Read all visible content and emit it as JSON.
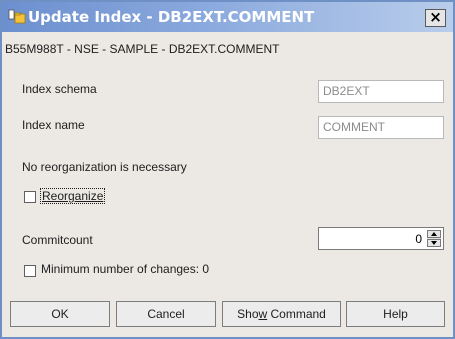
{
  "window": {
    "title": "Update Index - DB2EXT.COMMENT",
    "close_glyph": "×",
    "path_label": "B55M988T - NSE - SAMPLE - DB2EXT.COMMENT"
  },
  "fields": {
    "index_schema": {
      "label": "Index schema",
      "value": "DB2EXT"
    },
    "index_name": {
      "label": "Index name",
      "value": "COMMENT"
    }
  },
  "status": {
    "text": "No reorganization is necessary"
  },
  "reorganize": {
    "label": "Reorganize",
    "checked": false
  },
  "commitcount": {
    "label": "Commitcount",
    "value": "0"
  },
  "min_changes": {
    "label": "Minimum number of changes: 0",
    "checked": false
  },
  "buttons": {
    "ok": "OK",
    "cancel": "Cancel",
    "show_command_pre": "Sho",
    "show_command_mn": "w",
    "show_command_post": " Command",
    "help": "Help"
  },
  "icons": {
    "title": "db2-folder-icon",
    "close": "close-icon",
    "spinner": "spinner-arrows-icon"
  },
  "colors": {
    "title_gradient_start": "#6c8fcf",
    "title_gradient_end": "#b9cdeb",
    "window_bg": "#ece9e4",
    "window_border": "#6f90c5"
  }
}
